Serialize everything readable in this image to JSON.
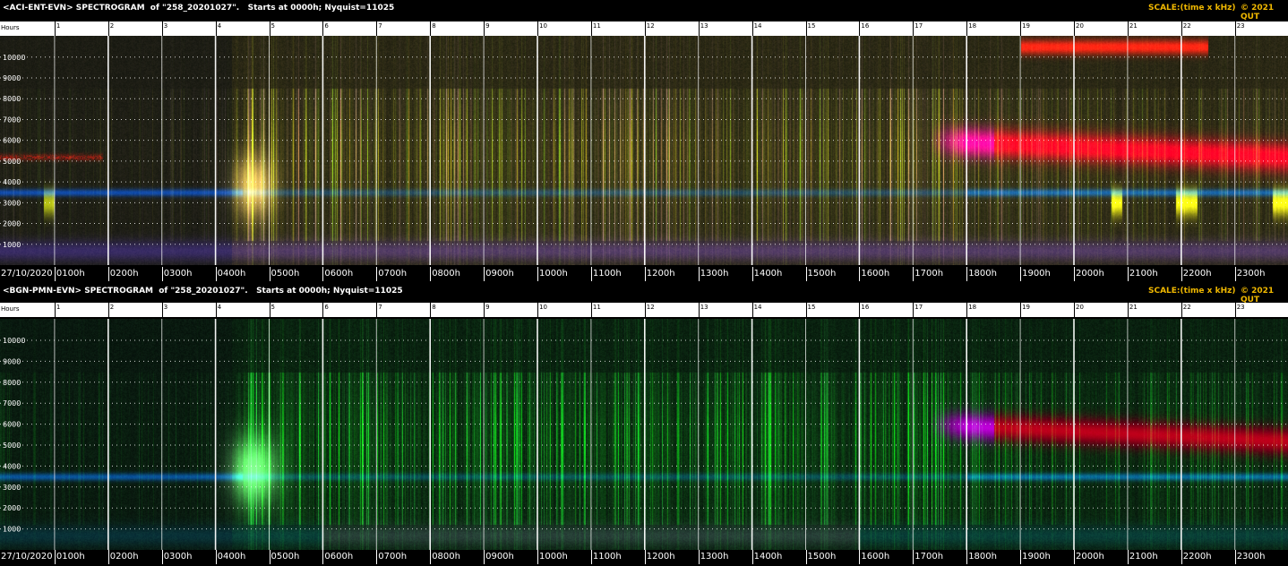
{
  "chart_data": [
    {
      "type": "heatmap",
      "title": "<ACI-ENT-EVN> SPECTROGRAM  of \"258_20201027\".   Starts at 0000h; Nyquist=11025",
      "scale_label": "SCALE:(time x kHz)",
      "copyright": "© 2021 QUT",
      "hours_label": "Hours",
      "hour_ticks": [
        "1",
        "2",
        "3",
        "4",
        "5",
        "6",
        "7",
        "8",
        "9",
        "10",
        "11",
        "12",
        "13",
        "14",
        "15",
        "16",
        "17",
        "18",
        "19",
        "20",
        "21",
        "22",
        "23"
      ],
      "y_ticks": [
        "1000",
        "2000",
        "3000",
        "4000",
        "5000",
        "6000",
        "7000",
        "8000",
        "9000",
        "10000"
      ],
      "x_tick_labels": [
        "27/10/2020",
        "0100h",
        "0200h",
        "0300h",
        "0400h",
        "0500h",
        "0600h",
        "0700h",
        "0800h",
        "0900h",
        "1000h",
        "1100h",
        "1200h",
        "1300h",
        "1400h",
        "1500h",
        "1600h",
        "1700h",
        "1800h",
        "1900h",
        "2000h",
        "2100h",
        "2200h",
        "2300h"
      ],
      "xlim": [
        0,
        24
      ],
      "ylim": [
        0,
        11025
      ],
      "palette": "ACI-ENT-EVN",
      "grid": true
    },
    {
      "type": "heatmap",
      "title": "<BGN-PMN-EVN> SPECTROGRAM  of \"258_20201027\".   Starts at 0000h; Nyquist=11025",
      "scale_label": "SCALE:(time x kHz)",
      "copyright": "© 2021 QUT",
      "hours_label": "Hours",
      "hour_ticks": [
        "1",
        "2",
        "3",
        "4",
        "5",
        "6",
        "7",
        "8",
        "9",
        "10",
        "11",
        "12",
        "13",
        "14",
        "15",
        "16",
        "17",
        "18",
        "19",
        "20",
        "21",
        "22",
        "23"
      ],
      "y_ticks": [
        "1000",
        "2000",
        "3000",
        "4000",
        "5000",
        "6000",
        "7000",
        "8000",
        "9000",
        "10000"
      ],
      "x_tick_labels": [
        "27/10/2020",
        "0100h",
        "0200h",
        "0300h",
        "0400h",
        "0500h",
        "0600h",
        "0700h",
        "0800h",
        "0900h",
        "1000h",
        "1100h",
        "1200h",
        "1300h",
        "1400h",
        "1500h",
        "1600h",
        "1700h",
        "1800h",
        "1900h",
        "2000h",
        "2100h",
        "2200h",
        "2300h"
      ],
      "xlim": [
        0,
        24
      ],
      "ylim": [
        0,
        11025
      ],
      "palette": "BGN-PMN-EVN",
      "grid": true
    }
  ],
  "colors": {
    "title": "#ffffff",
    "scale": "#f0b800",
    "hours_bg": "#ffffff",
    "grid_major": "#ffffff",
    "grid_minor": "#ffffff"
  }
}
